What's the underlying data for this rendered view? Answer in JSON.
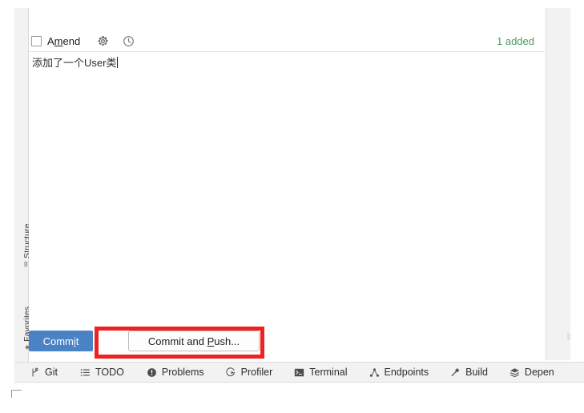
{
  "sidebar": {
    "items": [
      {
        "label": "Structure",
        "icon": "structure-icon"
      },
      {
        "label": "Favorites",
        "icon": "star-icon"
      }
    ]
  },
  "commit_panel": {
    "amend": {
      "label_prefix": "A",
      "label_mnemonic": "m",
      "label_suffix": "end",
      "checked": false,
      "gear_icon": "gear-icon",
      "history_icon": "clock-icon"
    },
    "added_status": "1 added",
    "added_color": "#4a9c5a",
    "message": "添加了一个User类",
    "buttons": {
      "commit": {
        "prefix": "Comm",
        "mnemonic": "i",
        "suffix": "t",
        "background": "#4a83c4",
        "text_color": "#ffffff"
      },
      "commit_and_push": {
        "prefix": "Commit and ",
        "mnemonic": "P",
        "suffix": "ush..."
      }
    }
  },
  "annotation": {
    "highlight_color": "#ee2222"
  },
  "bottom_bar": {
    "items": [
      {
        "label": "Git",
        "icon": "git-branch-icon"
      },
      {
        "label": "TODO",
        "icon": "list-icon"
      },
      {
        "label": "Problems",
        "icon": "exclamation-circle-icon"
      },
      {
        "label": "Profiler",
        "icon": "profiler-icon"
      },
      {
        "label": "Terminal",
        "icon": "terminal-icon"
      },
      {
        "label": "Endpoints",
        "icon": "endpoints-icon"
      },
      {
        "label": "Build",
        "icon": "hammer-icon"
      },
      {
        "label": "Depen",
        "icon": "layers-icon"
      }
    ]
  }
}
